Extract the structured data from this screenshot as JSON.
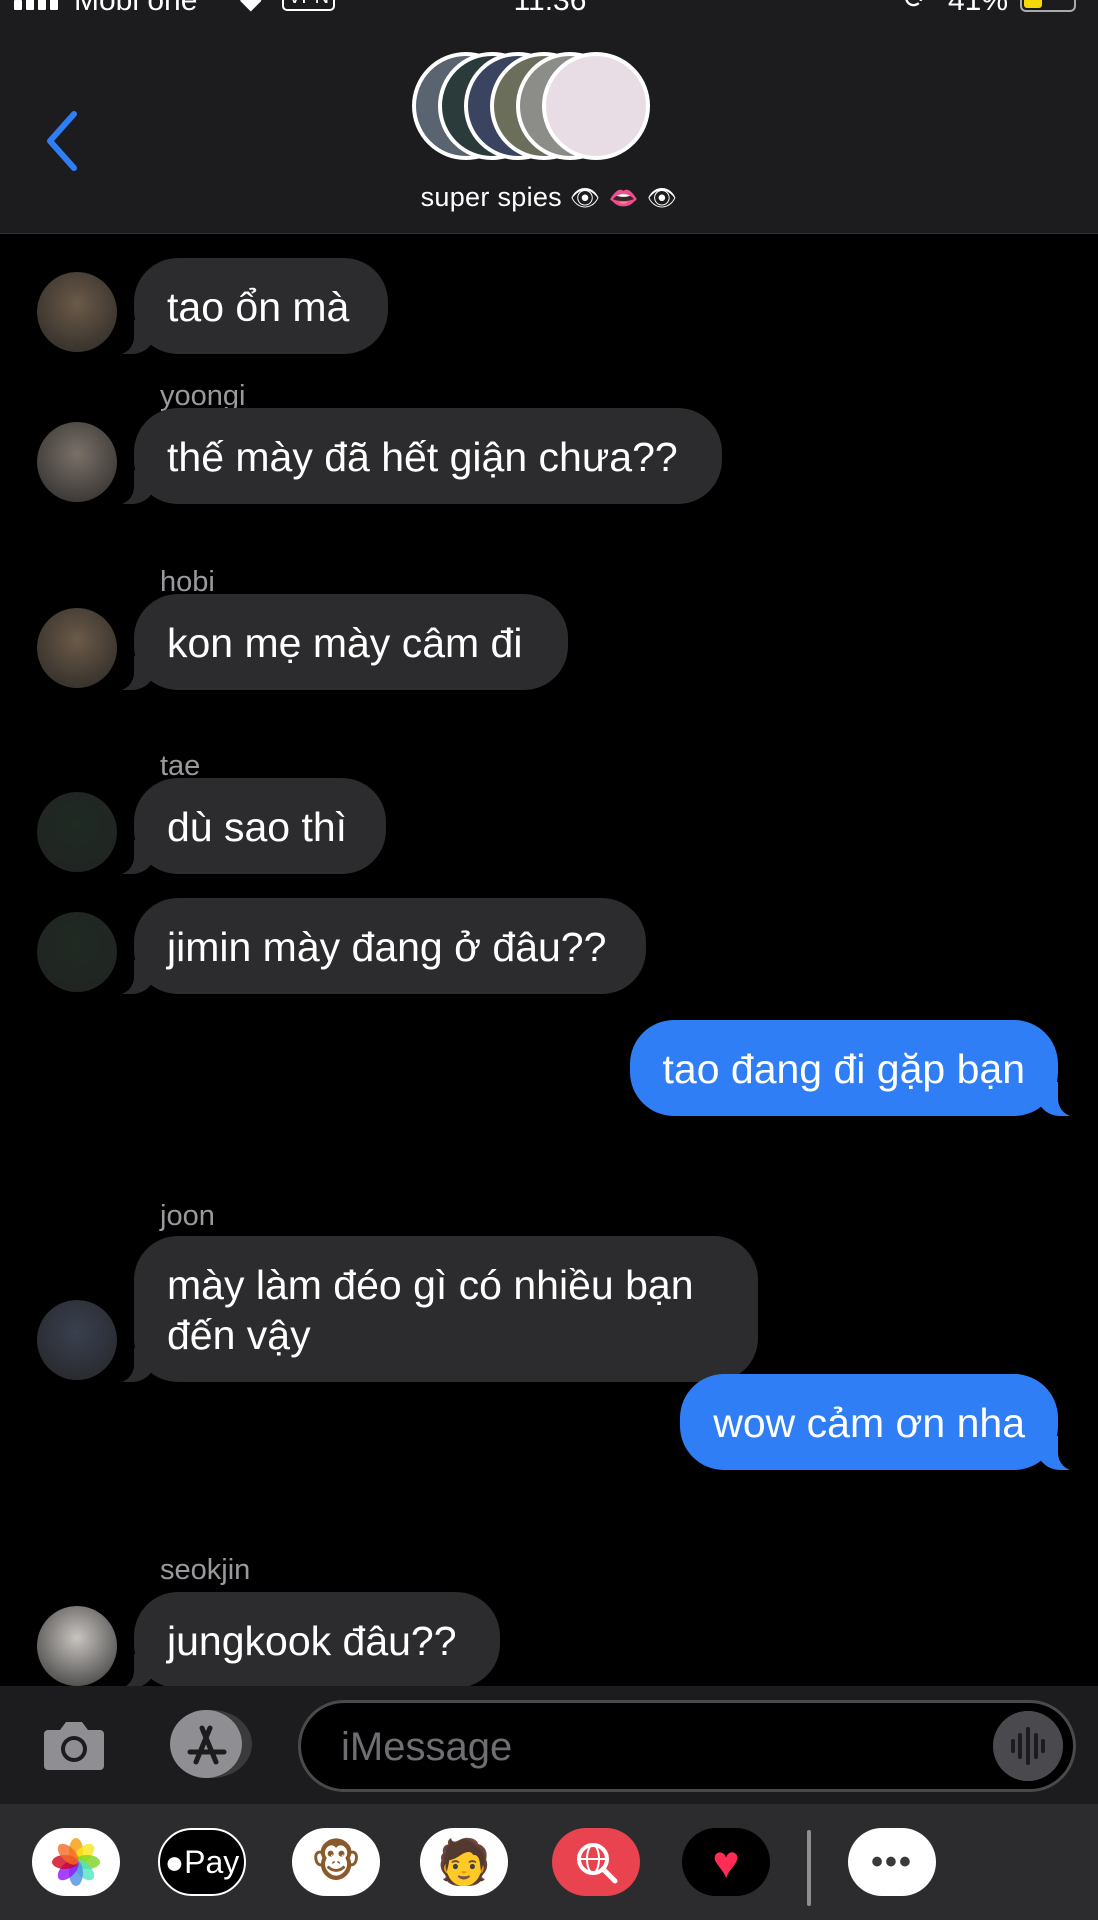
{
  "status_bar": {
    "carrier": "Mobi one",
    "vpn": "VPN",
    "time": "11:36",
    "battery_percent": "41%",
    "battery_level": 0.41
  },
  "header": {
    "group_name": "super spies",
    "group_emoji": "👁 👄 👁",
    "avatar_colors": [
      "#5a6470",
      "#2b3a3a",
      "#3a4460",
      "#6a6e5a",
      "#8c8c88",
      "#e8dde4"
    ]
  },
  "messages": [
    {
      "side": "in",
      "sender": "",
      "text": "tao ổn mà",
      "avatar_color": "#6b5a48"
    },
    {
      "side": "in",
      "sender": "yoongi",
      "text": "thế mày đã hết giận chưa??",
      "avatar_color": "#7a7068"
    },
    {
      "side": "in",
      "sender": "hobi",
      "text": "kon mẹ mày câm đi",
      "avatar_color": "#6b5a48"
    },
    {
      "side": "in",
      "sender": "tae",
      "text": "dù sao thì",
      "avatar_color": "#1e2a22"
    },
    {
      "side": "in",
      "sender": "",
      "text": "jimin mày đang ở đâu??",
      "avatar_color": "#1e2a22"
    },
    {
      "side": "out",
      "sender": "",
      "text": "tao đang đi gặp bạn"
    },
    {
      "side": "in",
      "sender": "joon",
      "text": "mày làm đéo gì có nhiều bạn",
      "text2": "đến vậy",
      "avatar_color": "#3a4050"
    },
    {
      "side": "out",
      "sender": "",
      "text": "wow cảm ơn nha"
    },
    {
      "side": "in",
      "sender": "seokjin",
      "text": "jungkook đâu??",
      "avatar_color": "#c8c4c0"
    }
  ],
  "input": {
    "placeholder": "iMessage"
  },
  "apps": [
    {
      "name": "photos-app",
      "label": ""
    },
    {
      "name": "apple-pay-app",
      "label": "Pay"
    },
    {
      "name": "animoji-app",
      "label": "🐵"
    },
    {
      "name": "memoji-app",
      "label": "🧑"
    },
    {
      "name": "images-search-app",
      "label": ""
    },
    {
      "name": "digital-touch-app",
      "label": "♥"
    },
    {
      "name": "more-apps",
      "label": "•••"
    }
  ],
  "colors": {
    "accent": "#2f7ef6",
    "incoming_bubble": "#2c2c2e",
    "bar_background": "#1c1c1e"
  }
}
